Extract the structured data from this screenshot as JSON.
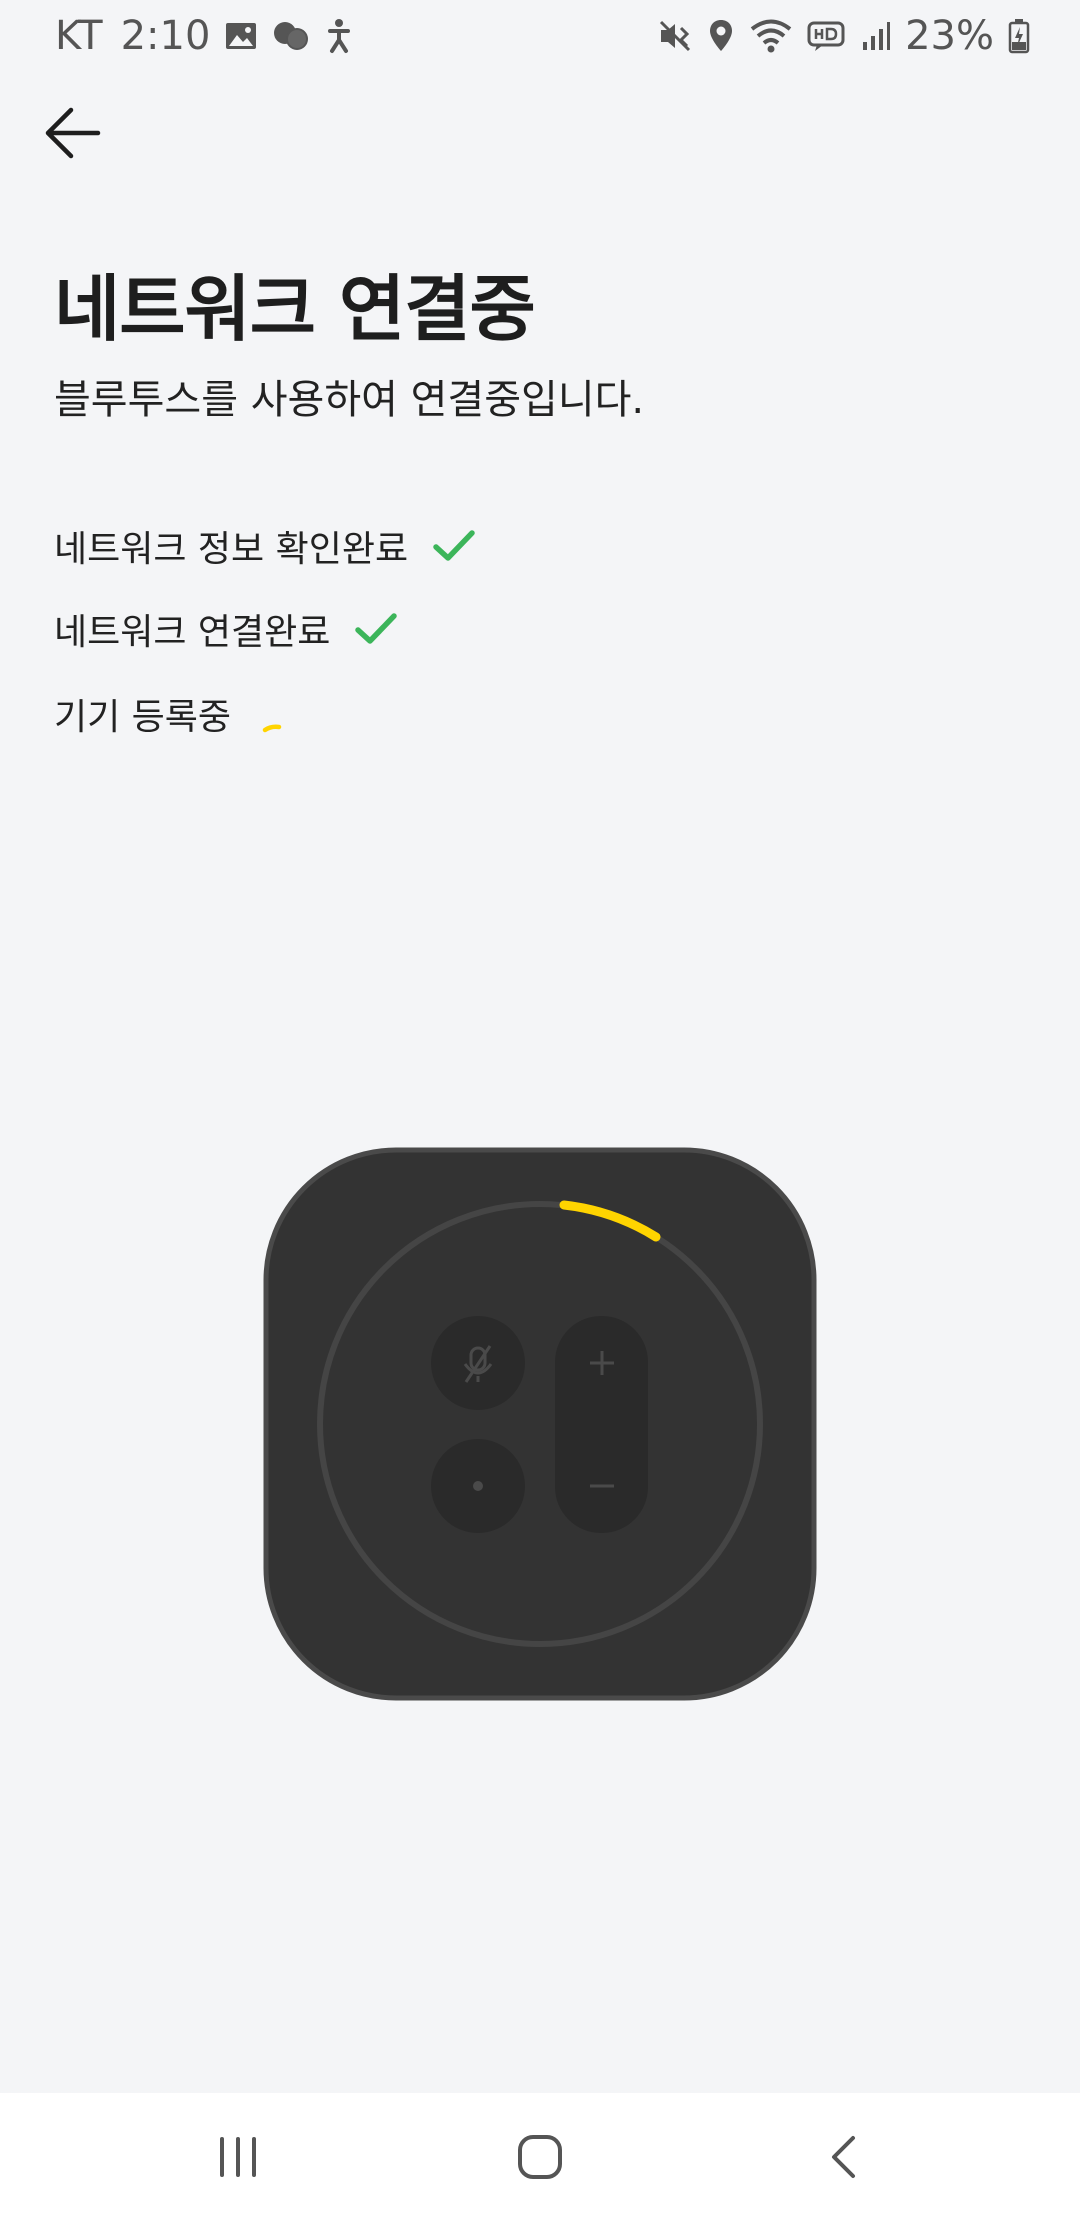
{
  "status_bar": {
    "carrier": "KT",
    "time": "2:10",
    "battery": "23%",
    "left_icons": [
      "gallery-icon",
      "chat-bubbles-icon",
      "accessibility-icon"
    ],
    "right_icons": [
      "mute-vibrate-icon",
      "location-icon",
      "wifi-icon",
      "hd-voice-icon",
      "signal-icon",
      "battery-charging-icon"
    ]
  },
  "header": {
    "back_icon": "arrow-left-icon"
  },
  "main": {
    "title": "네트워크 연결중",
    "subtitle": "블루투스를 사용하여 연결중입니다.",
    "steps": [
      {
        "label": "네트워크 정보 확인완료",
        "status": "done"
      },
      {
        "label": "네트워크 연결완료",
        "status": "done"
      },
      {
        "label": "기기 등록중",
        "status": "in-progress"
      }
    ]
  },
  "device": {
    "buttons": [
      "mic-mute-icon",
      "plus-icon",
      "dot-icon",
      "minus-icon"
    ]
  },
  "colors": {
    "background": "#f4f5f7",
    "check": "#3cb55a",
    "accent": "#ffd400",
    "device_body": "#333333"
  },
  "nav_bar": {
    "icons": [
      "recents-icon",
      "home-icon",
      "back-chevron-icon"
    ]
  }
}
